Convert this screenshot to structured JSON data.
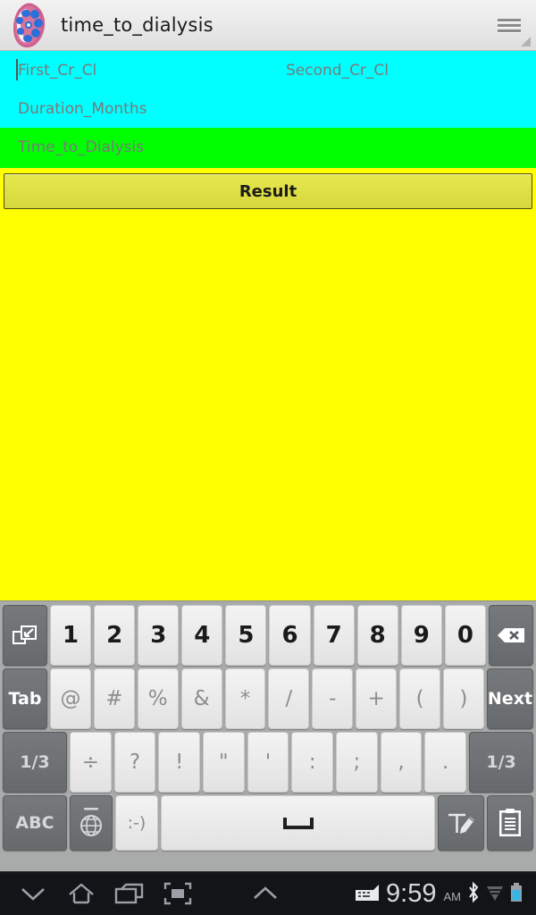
{
  "titlebar": {
    "app_icon_name": "kidney-app-icon",
    "title": "time_to_dialysis",
    "menu_icon_name": "hamburger-menu-icon"
  },
  "form": {
    "cyan_color": "#00FFFF",
    "green_color": "#00FF00",
    "yellow_color": "#FFFF00",
    "fields": [
      {
        "name": "first-cr-cl",
        "placeholder": "First_Cr_Cl",
        "value": "",
        "focused": true
      },
      {
        "name": "second-cr-cl",
        "placeholder": "Second_Cr_Cl",
        "value": "",
        "focused": false
      },
      {
        "name": "duration-months",
        "placeholder": "Duration_Months",
        "value": "",
        "focused": false
      },
      {
        "name": "time-to-dialysis",
        "placeholder": "Time_to_Dialysis",
        "value": "",
        "focused": false
      }
    ],
    "result_button_label": "Result"
  },
  "keyboard": {
    "row1": [
      {
        "name": "restore-window-key",
        "label": "",
        "icon": "restore-window-icon",
        "style": "dark"
      },
      {
        "name": "key-1",
        "label": "1",
        "style": "light-num"
      },
      {
        "name": "key-2",
        "label": "2",
        "style": "light-num"
      },
      {
        "name": "key-3",
        "label": "3",
        "style": "light-num"
      },
      {
        "name": "key-4",
        "label": "4",
        "style": "light-num"
      },
      {
        "name": "key-5",
        "label": "5",
        "style": "light-num"
      },
      {
        "name": "key-6",
        "label": "6",
        "style": "light-num"
      },
      {
        "name": "key-7",
        "label": "7",
        "style": "light-num"
      },
      {
        "name": "key-8",
        "label": "8",
        "style": "light-num"
      },
      {
        "name": "key-9",
        "label": "9",
        "style": "light-num"
      },
      {
        "name": "key-0",
        "label": "0",
        "style": "light-num"
      },
      {
        "name": "backspace-key",
        "label": "",
        "icon": "backspace-icon",
        "style": "dark"
      }
    ],
    "row2": [
      {
        "name": "tab-key",
        "label": "Tab",
        "style": "dark"
      },
      {
        "name": "key-at",
        "label": "@",
        "style": "light"
      },
      {
        "name": "key-hash",
        "label": "#",
        "style": "light"
      },
      {
        "name": "key-percent",
        "label": "%",
        "style": "light"
      },
      {
        "name": "key-ampersand",
        "label": "&",
        "style": "light"
      },
      {
        "name": "key-asterisk",
        "label": "*",
        "style": "light"
      },
      {
        "name": "key-slash",
        "label": "/",
        "style": "light"
      },
      {
        "name": "key-hyphen",
        "label": "-",
        "style": "light"
      },
      {
        "name": "key-plus",
        "label": "+",
        "style": "light"
      },
      {
        "name": "key-paren-open",
        "label": "(",
        "style": "light"
      },
      {
        "name": "key-paren-close",
        "label": ")",
        "style": "light"
      },
      {
        "name": "next-key",
        "label": "Next",
        "style": "dark"
      }
    ],
    "row3": [
      {
        "name": "page-left-key",
        "label": "1/3",
        "style": "dark"
      },
      {
        "name": "key-divide",
        "label": "÷",
        "style": "light"
      },
      {
        "name": "key-question",
        "label": "?",
        "style": "light"
      },
      {
        "name": "key-exclamation",
        "label": "!",
        "style": "light"
      },
      {
        "name": "key-quote-double",
        "label": "\"",
        "style": "light"
      },
      {
        "name": "key-quote-single",
        "label": "'",
        "style": "light"
      },
      {
        "name": "key-colon",
        "label": ":",
        "style": "light"
      },
      {
        "name": "key-semicolon",
        "label": ";",
        "style": "light"
      },
      {
        "name": "key-comma",
        "label": ",",
        "style": "light"
      },
      {
        "name": "key-period",
        "label": ".",
        "style": "light"
      },
      {
        "name": "page-right-key",
        "label": "1/3",
        "style": "dark"
      }
    ],
    "row4": [
      {
        "name": "abc-key",
        "label": "ABC",
        "style": "dark"
      },
      {
        "name": "language-globe-key",
        "label": "",
        "icon": "globe-icon",
        "style": "dark"
      },
      {
        "name": "emoji-key",
        "label": ":-)",
        "style": "light"
      },
      {
        "name": "space-key",
        "label": "",
        "icon": "space-icon",
        "style": "light"
      },
      {
        "name": "handwriting-key",
        "label": "",
        "icon": "text-pencil-icon",
        "style": "dark"
      },
      {
        "name": "clipboard-key",
        "label": "",
        "icon": "clipboard-icon",
        "style": "dark"
      }
    ]
  },
  "navbar": {
    "items": [
      {
        "name": "hide-keyboard-button",
        "icon": "chevron-down-icon"
      },
      {
        "name": "home-button",
        "icon": "home-icon"
      },
      {
        "name": "recents-button",
        "icon": "recents-icon"
      },
      {
        "name": "screenshot-button",
        "icon": "screenshot-frame-icon"
      },
      {
        "name": "expand-button",
        "icon": "chevron-up-icon"
      }
    ],
    "status": {
      "keyboard_indicator": "keyboard-icon",
      "time": "9:59",
      "ampm": "AM",
      "bluetooth_icon": "bluetooth-icon",
      "signal_icon": "signal-bars-icon",
      "battery_icon": "battery-icon",
      "battery_color": "#33B5E5"
    }
  }
}
